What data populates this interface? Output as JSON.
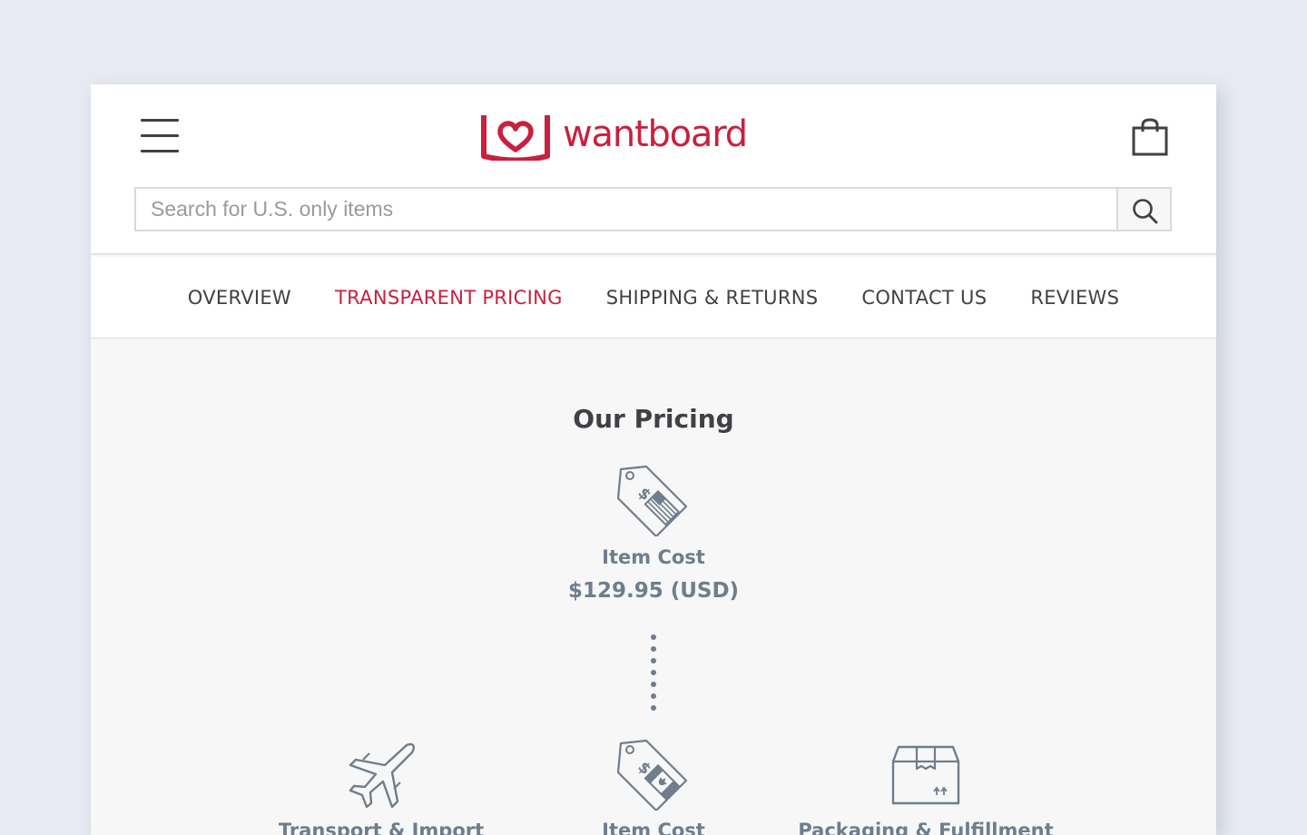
{
  "brand": {
    "name": "wantboard",
    "color": "#c8203f"
  },
  "header": {
    "menu_icon": "hamburger-menu-icon",
    "cart_icon": "shopping-bag-icon",
    "search": {
      "placeholder": "Search for U.S. only items",
      "value": "",
      "icon": "search-icon"
    }
  },
  "tabs": [
    {
      "label": "OVERVIEW",
      "active": false
    },
    {
      "label": "TRANSPARENT PRICING",
      "active": true
    },
    {
      "label": "SHIPPING & RETURNS",
      "active": false
    },
    {
      "label": "CONTACT US",
      "active": false
    },
    {
      "label": "REVIEWS",
      "active": false
    }
  ],
  "pricing": {
    "title": "Our Pricing",
    "item": {
      "label": "Item Cost",
      "price": "$129.95 (USD)",
      "icon": "us-price-tag-icon"
    },
    "breakdown": [
      {
        "label": "Transport & Import",
        "icon": "airplane-icon"
      },
      {
        "label": "Item Cost",
        "icon": "canada-price-tag-icon"
      },
      {
        "label": "Packaging & Fulfillment",
        "icon": "package-box-icon"
      }
    ]
  },
  "colors": {
    "accent": "#c8203f",
    "text": "#3f4144",
    "muted": "#6f7d8c",
    "content_bg": "#f7f7f7",
    "page_bg": "#e7eaf2"
  }
}
